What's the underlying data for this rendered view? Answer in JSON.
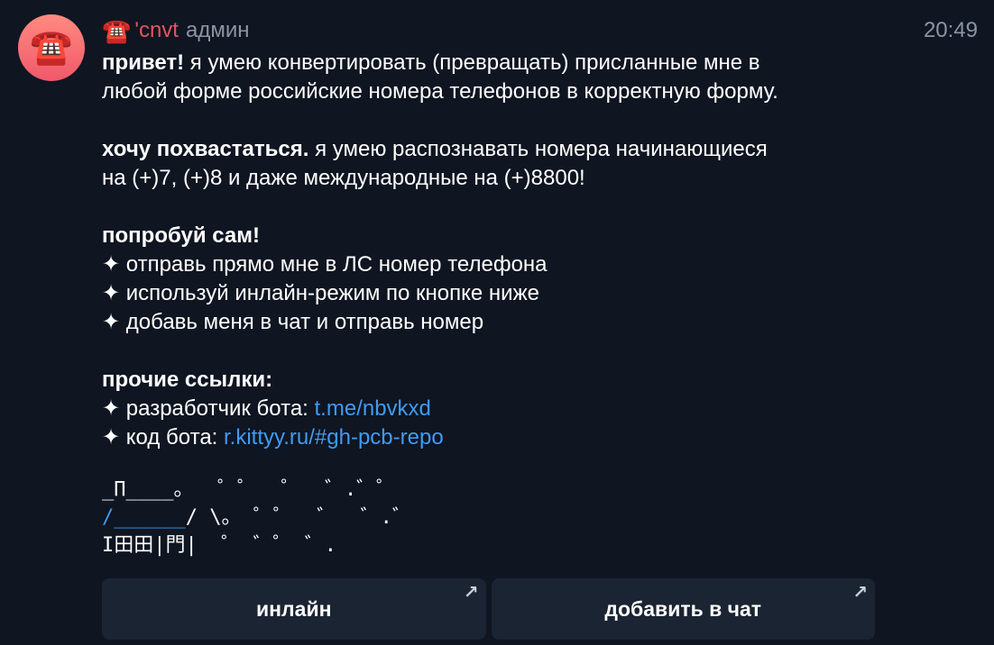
{
  "message": {
    "avatar_icon": "telephone-icon",
    "avatar_emoji": "☎️",
    "sender_emoji": "☎️",
    "sender_name": "'cnvt",
    "sender_badge": "админ",
    "time": "20:49",
    "accent_color": "#e0565b",
    "link_color": "#3f9bf2"
  },
  "text": {
    "intro_bold": "привет!",
    "intro_line1": " я умею конвертировать (превращать) присланные мне в",
    "intro_line2": "любой форме российские номера телефонов в корректную форму.",
    "brag_bold": "хочу похвастаться.",
    "brag_line1": " я умею распознавать номера начинающиеся",
    "brag_line2": "на (+)7, (+)8 и даже международные на (+)8800!",
    "try_heading": "попробуй сам!",
    "try_items": [
      "✦ отправь прямо мне в ЛС номер телефона",
      "✦ используй инлайн-режим по кнопке ниже",
      "✦ добавь меня в чат и отправь номер"
    ],
    "links_heading": "прочие ссылки:",
    "dev_label": "✦ разработчик бота: ",
    "dev_link": "t.me/nbvkxd",
    "code_label": "✦ код бота: ",
    "code_link": "r.kittyy.ru/#gh-pcb-repo"
  },
  "ascii_art": {
    "line1": "_Π____。  ゜゜  ゜  ゛.゛゜",
    "line2_blue": "/______",
    "line2_rest": "/ \\。 ゜゜  ゛  ゛.゛",
    "line3": "I田田|門|  ゜ ゛゜ ゛."
  },
  "keyboard": {
    "buttons": [
      {
        "label": "инлайн",
        "icon": "arrow-up-right-icon"
      },
      {
        "label": "добавить в чат",
        "icon": "arrow-up-right-icon"
      }
    ]
  }
}
